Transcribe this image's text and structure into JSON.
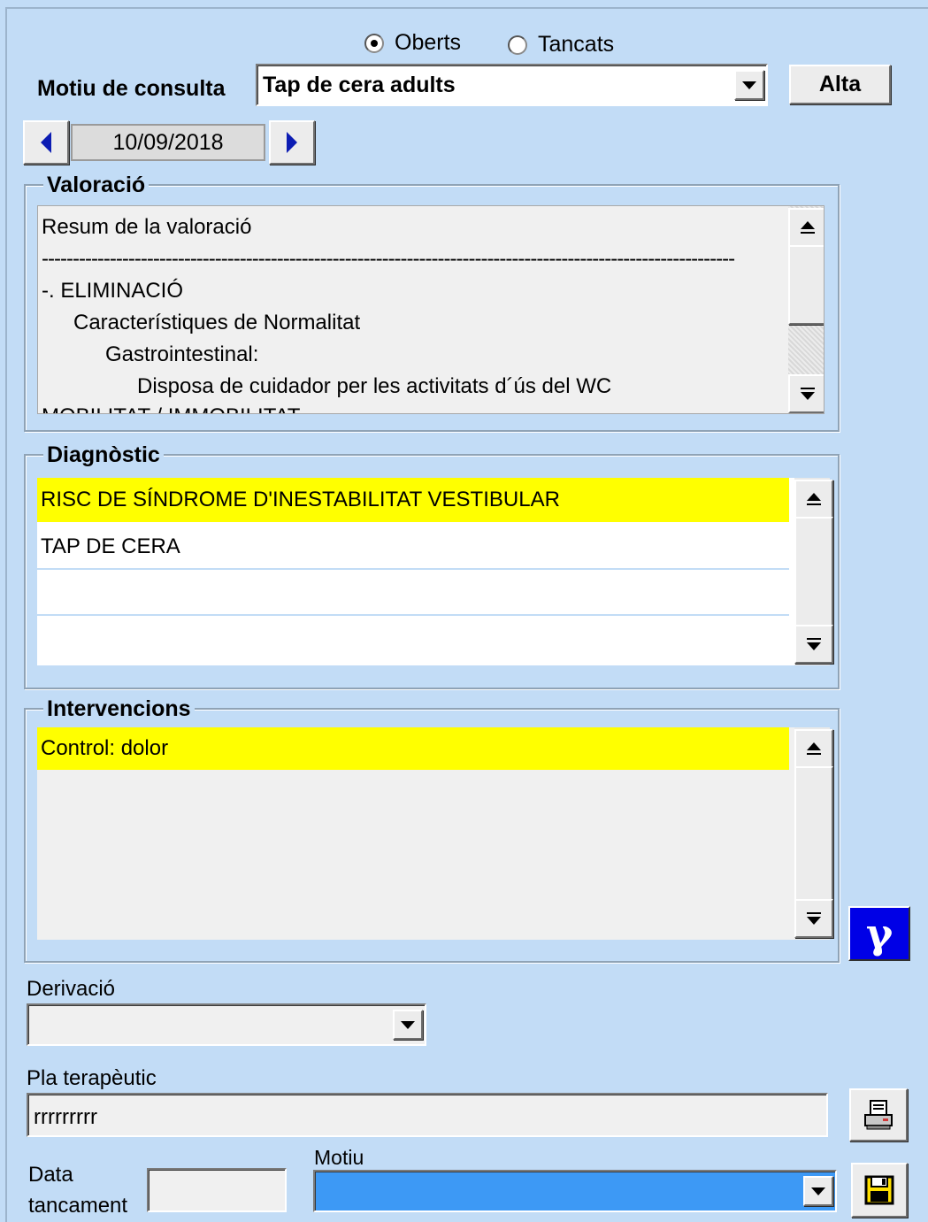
{
  "status_filter": {
    "options": [
      {
        "label": "Oberts",
        "selected": true
      },
      {
        "label": "Tancats",
        "selected": false
      }
    ]
  },
  "motiu_consulta": {
    "label": "Motiu de consulta",
    "value": "Tap de cera adults",
    "alta_button": "Alta"
  },
  "date_nav": {
    "date": "10/09/2018"
  },
  "valoracio": {
    "title": "Valoració",
    "lines": [
      "Resum de la valoració",
      "----------------------------------------------------------------------------------------------------------------",
      "-. ELIMINACIÓ",
      "Característiques de Normalitat",
      "Gastrointestinal:",
      "Disposa de cuidador per les activitats d´ús del WC",
      "MOBILITAT / IMMOBILITAT"
    ]
  },
  "diagnostic": {
    "title": "Diagnòstic",
    "rows": [
      "RISC DE SÍNDROME D'INESTABILITAT VESTIBULAR",
      "TAP DE CERA",
      "",
      ""
    ],
    "highlight_color": "#ffff00"
  },
  "intervencions": {
    "title": "Intervencions",
    "rows": [
      "Control: dolor"
    ],
    "highlight_color": "#ffff00",
    "gamma_button": "γ"
  },
  "derivacio": {
    "label": "Derivació",
    "value": ""
  },
  "pla_terapeutic": {
    "label": "Pla terapèutic",
    "value": "rrrrrrrrr"
  },
  "tancament": {
    "data_label_line1": "Data",
    "data_label_line2": "tancament",
    "date_value": "",
    "motiu_label": "Motiu",
    "motiu_value": ""
  },
  "colors": {
    "background": "#c2dcf6",
    "highlight": "#ffff00",
    "selection_blue": "#3d99f5",
    "gamma_button": "#0000e6",
    "nav_arrow": "#0c1cb3"
  },
  "icons": {
    "print": "printer-icon",
    "save": "floppy-disk-icon",
    "prev": "left-arrow-icon",
    "next": "right-arrow-icon"
  }
}
